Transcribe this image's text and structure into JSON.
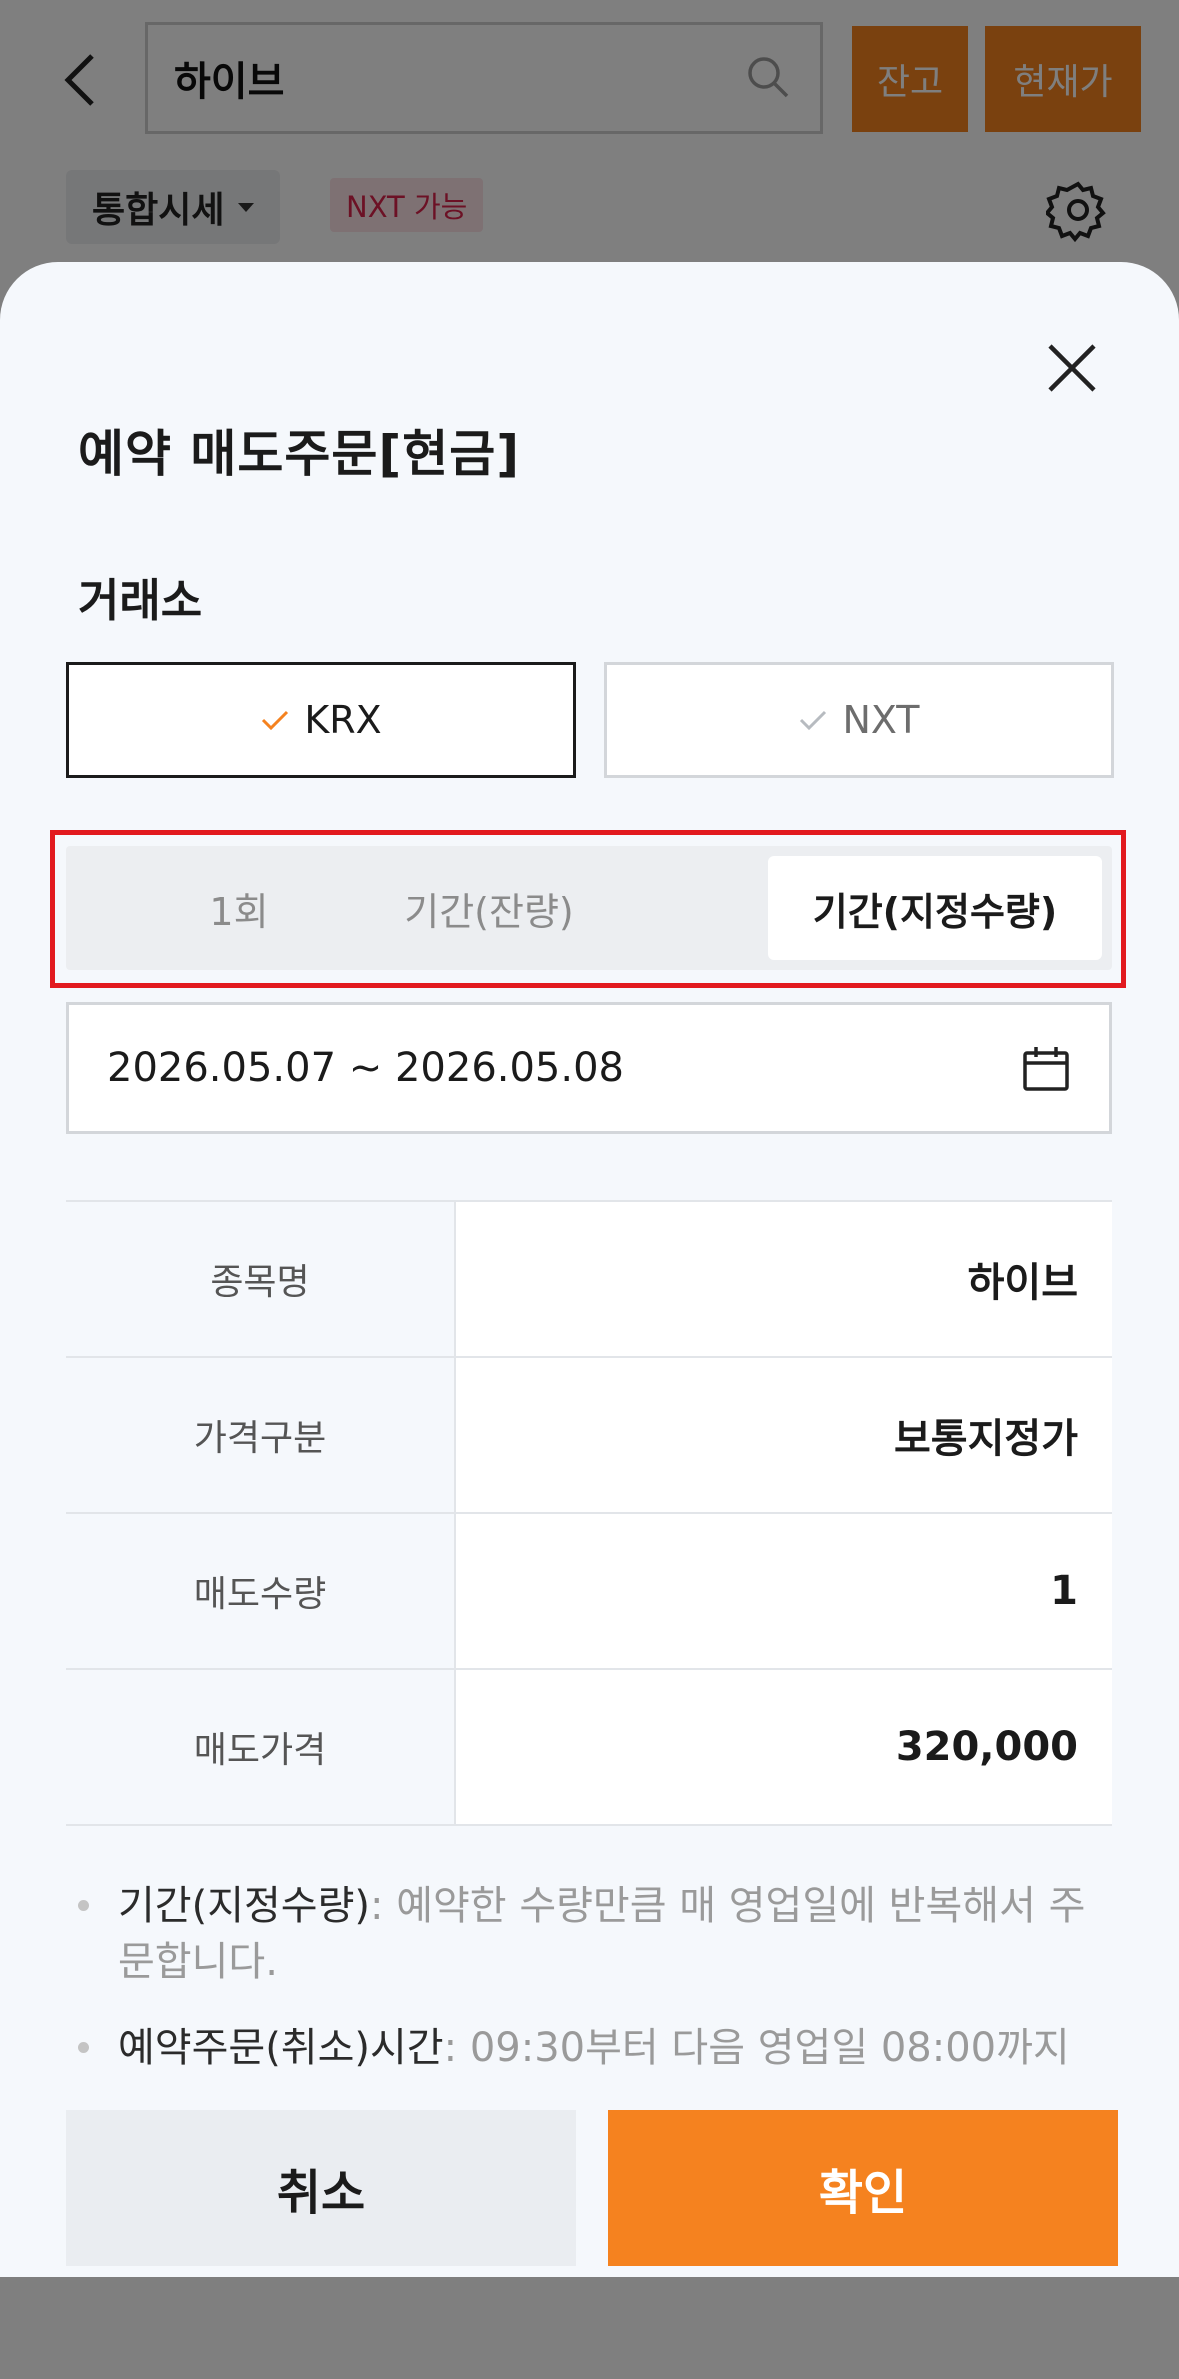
{
  "header": {
    "search_value": "하이브",
    "balance_button": "잔고",
    "price_button": "현재가",
    "market_selector": "통합시세",
    "nxt_badge": "NXT 가능"
  },
  "sheet": {
    "title": "예약 매도주문[현금]",
    "exchange_label": "거래소",
    "exchanges": [
      {
        "label": "KRX",
        "selected": true
      },
      {
        "label": "NXT",
        "selected": false
      }
    ],
    "period_tabs": [
      {
        "label": "1회",
        "selected": false
      },
      {
        "label": "기간(잔량)",
        "selected": false
      },
      {
        "label": "기간(지정수량)",
        "selected": true
      }
    ],
    "date_range": "2026.05.07 ~ 2026.05.08",
    "rows": [
      {
        "label": "종목명",
        "value": "하이브"
      },
      {
        "label": "가격구분",
        "value": "보통지정가"
      },
      {
        "label": "매도수량",
        "value": "1"
      },
      {
        "label": "매도가격",
        "value": "320,000"
      }
    ],
    "notes": [
      {
        "key": "기간(지정수량)",
        "text": ": 예약한 수량만큼 매 영업일에 반복해서 주문합니다."
      },
      {
        "key": "예약주문(취소)시간",
        "text": ": 09:30부터 다음 영업일 08:00까지"
      }
    ],
    "cancel_button": "취소",
    "confirm_button": "확인"
  },
  "colors": {
    "accent": "#f5821f",
    "highlight_border": "#e21a1f",
    "nxt_badge_text": "#d9234a"
  }
}
